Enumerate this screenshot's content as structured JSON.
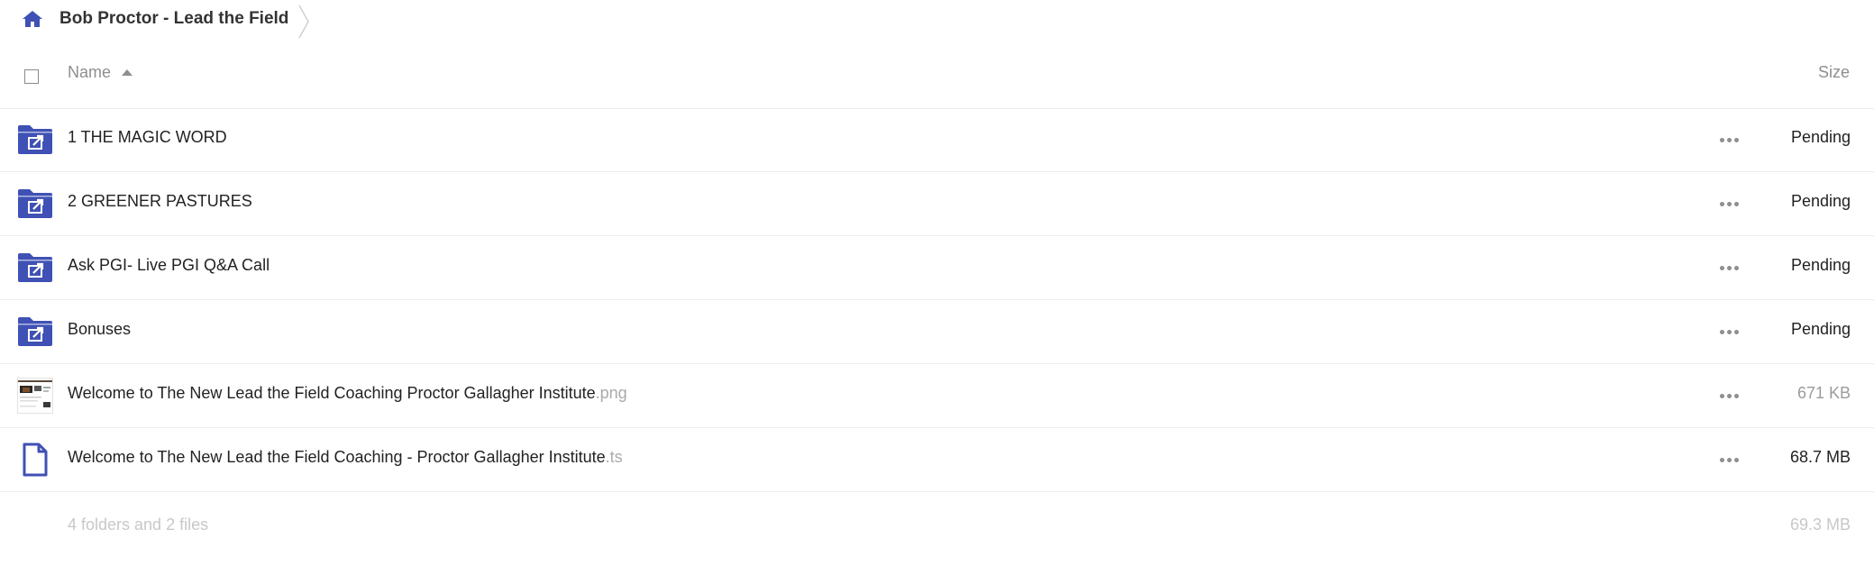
{
  "breadcrumb": {
    "current": "Bob Proctor - Lead the Field",
    "home_icon": "home-icon"
  },
  "header": {
    "name_label": "Name",
    "size_label": "Size",
    "sort_direction": "ascending"
  },
  "colors": {
    "accent": "#3f51b5",
    "text": "#222222",
    "muted": "#8f8f8f",
    "faint": "#c8c8c8",
    "divider": "#ececec"
  },
  "files": [
    {
      "name": "1  THE MAGIC WORD",
      "ext": "",
      "size": "Pending",
      "type": "shared-folder",
      "icon": "shared-folder-icon"
    },
    {
      "name": "2  GREENER PASTURES",
      "ext": "",
      "size": "Pending",
      "type": "shared-folder",
      "icon": "shared-folder-icon"
    },
    {
      "name": "Ask PGI- Live PGI Q&A Call",
      "ext": "",
      "size": "Pending",
      "type": "shared-folder",
      "icon": "shared-folder-icon"
    },
    {
      "name": "Bonuses",
      "ext": "",
      "size": "Pending",
      "type": "shared-folder",
      "icon": "shared-folder-icon"
    },
    {
      "name": "Welcome to The New Lead the Field Coaching   Proctor Gallagher Institute",
      "ext": ".png",
      "size": "671 KB",
      "type": "image",
      "icon": "image-thumbnail"
    },
    {
      "name": "Welcome to The New Lead the Field Coaching - Proctor Gallagher Institute",
      "ext": ".ts",
      "size": "68.7 MB",
      "type": "file",
      "icon": "file-icon"
    }
  ],
  "summary": {
    "text": "4 folders and 2 files",
    "total_size": "69.3 MB"
  }
}
